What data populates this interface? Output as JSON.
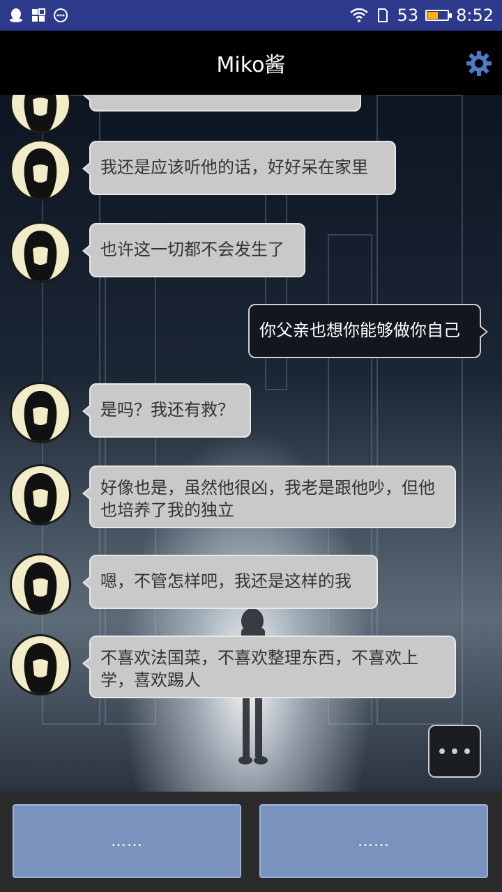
{
  "status_bar": {
    "left_icons": [
      "qq-icon",
      "apps-icon",
      "messages-icon"
    ],
    "signal": "53",
    "time": "8:52",
    "battery_level": 0.53
  },
  "header": {
    "title": "Miko酱",
    "settings_icon": "gear-icon",
    "accent": "#4f78c8"
  },
  "messages": [
    {
      "from": "miko",
      "text": "我还是应该听他的话，好好呆在家里"
    },
    {
      "from": "miko",
      "text": "也许这一切都不会发生了"
    },
    {
      "from": "me",
      "text": "你父亲也想你能够做你自己"
    },
    {
      "from": "miko",
      "text": "是吗？我还有救？"
    },
    {
      "from": "miko",
      "text": "好像也是，虽然他很凶，我老是跟他吵，但他也培养了我的独立"
    },
    {
      "from": "miko",
      "text": "嗯，不管怎样吧，我还是这样的我"
    },
    {
      "from": "miko",
      "text": "不喜欢法国菜，不喜欢整理东西，不喜欢上学，喜欢踢人"
    }
  ],
  "choices": [
    {
      "label": "……"
    },
    {
      "label": "……"
    }
  ]
}
